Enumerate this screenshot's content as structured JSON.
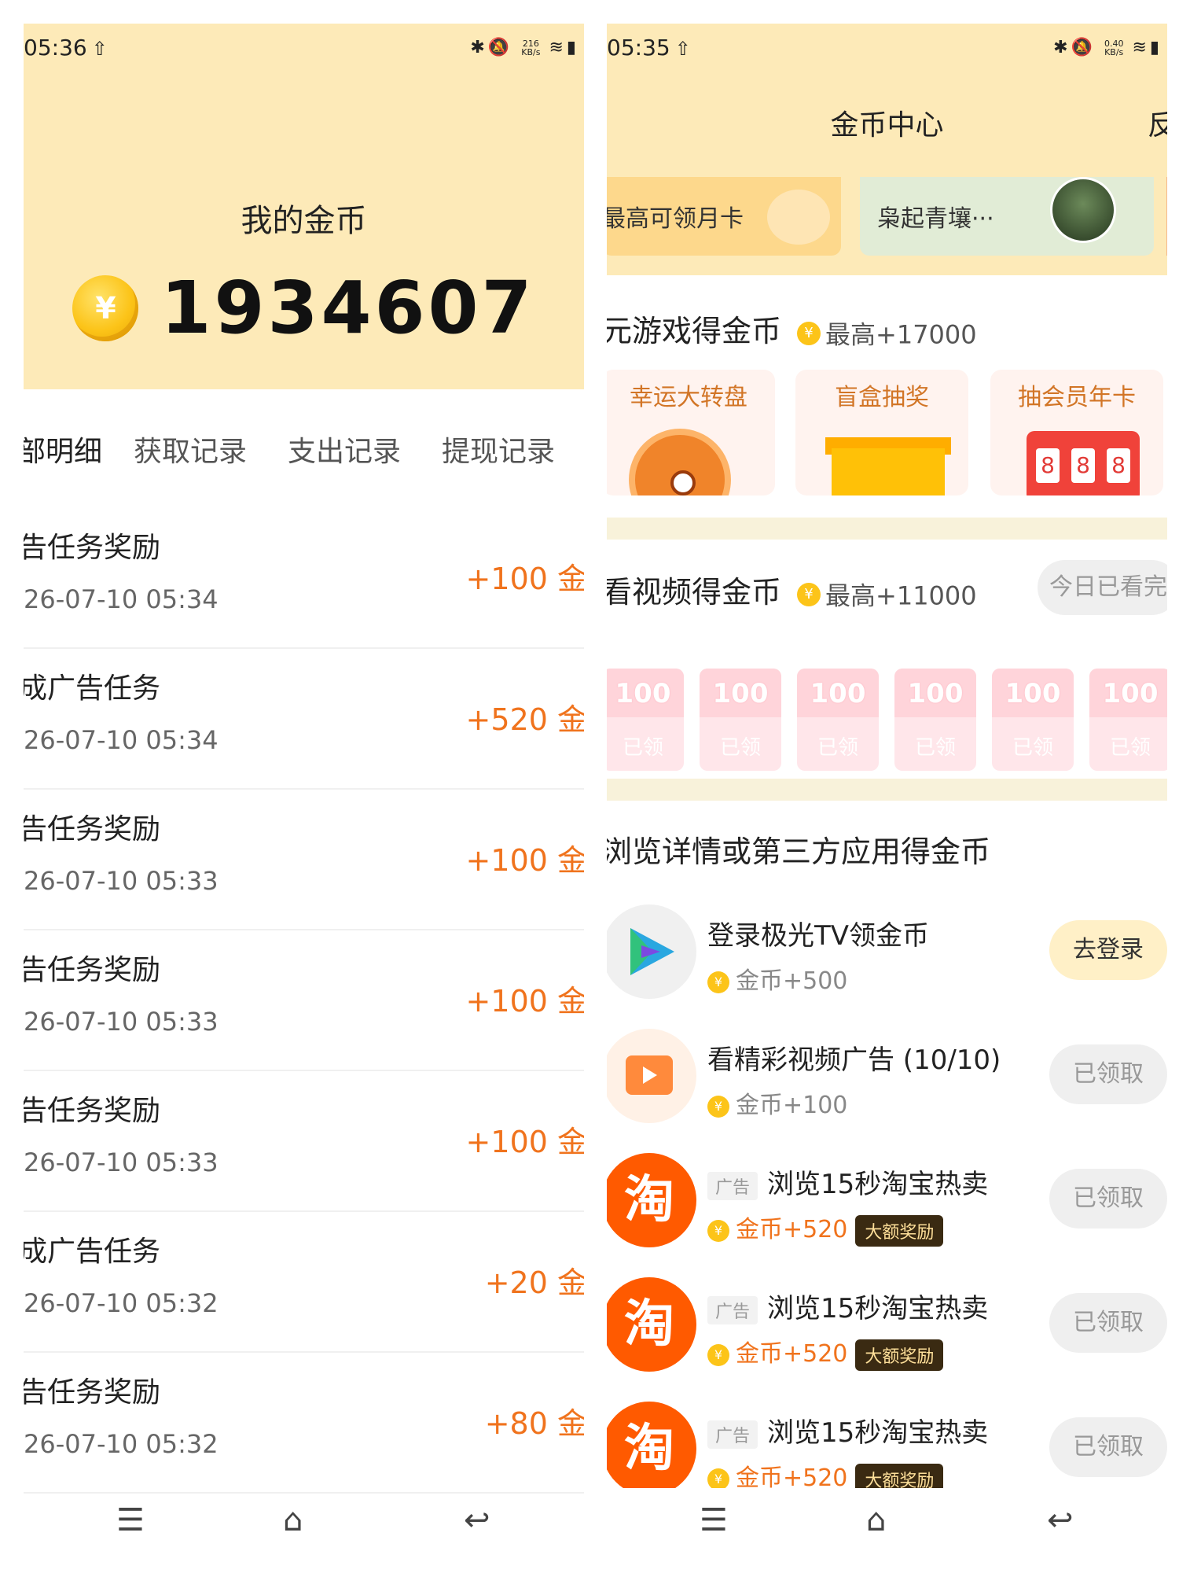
{
  "left": {
    "status": {
      "time": "05:36",
      "speed_value": "216",
      "speed_unit": "KB/s"
    },
    "header": {
      "title": "我的金币",
      "coin_symbol": "¥",
      "balance": "1934607"
    },
    "tabs": [
      "部明细",
      "获取记录",
      "支出记录",
      "提现记录"
    ],
    "records": [
      {
        "title": "告任务奖励",
        "time": "26-07-10 05:34",
        "amount": "+100 金"
      },
      {
        "title": "成广告任务",
        "time": "26-07-10 05:34",
        "amount": "+520 金"
      },
      {
        "title": "告任务奖励",
        "time": "26-07-10 05:33",
        "amount": "+100 金"
      },
      {
        "title": "告任务奖励",
        "time": "26-07-10 05:33",
        "amount": "+100 金"
      },
      {
        "title": "告任务奖励",
        "time": "26-07-10 05:33",
        "amount": "+100 金"
      },
      {
        "title": "成广告任务",
        "time": "26-07-10 05:32",
        "amount": "+20 金"
      },
      {
        "title": "告任务奖励",
        "time": "26-07-10 05:32",
        "amount": "+80 金"
      }
    ]
  },
  "right": {
    "status": {
      "time": "05:35",
      "speed_value": "0.40",
      "speed_unit": "KB/s"
    },
    "header": {
      "title": "金币中心",
      "feedback": "反"
    },
    "cards": [
      {
        "text": "最高可领月卡"
      },
      {
        "text": "枭起青壤···"
      }
    ],
    "games": {
      "title": "元游戏得金币",
      "max": "最高+17000",
      "items": [
        {
          "label": "幸运大转盘"
        },
        {
          "label": "盲盒抽奖"
        },
        {
          "label": "抽会员年卡",
          "digits": [
            "8",
            "8",
            "8"
          ]
        }
      ]
    },
    "videos": {
      "title": "看视频得金币",
      "max": "最高+11000",
      "status": "今日已看完",
      "envelopes": [
        {
          "num": "100",
          "label": "已领"
        },
        {
          "num": "100",
          "label": "已领"
        },
        {
          "num": "100",
          "label": "已领"
        },
        {
          "num": "100",
          "label": "已领"
        },
        {
          "num": "100",
          "label": "已领"
        },
        {
          "num": "100",
          "label": "已领"
        }
      ]
    },
    "browse": {
      "title": "浏览详情或第三方应用得金币",
      "tasks": [
        {
          "title": "登录极光TV领金币",
          "reward": "金币+500",
          "button": "去登录"
        },
        {
          "title": "看精彩视频广告 (10/10)",
          "reward": "金币+100",
          "button": "已领取"
        },
        {
          "ad": "广告",
          "title": "浏览15秒淘宝热卖",
          "reward": "金币+520",
          "badge": "大额奖励",
          "button": "已领取",
          "icon_char": "淘"
        },
        {
          "ad": "广告",
          "title": "浏览15秒淘宝热卖",
          "reward": "金币+520",
          "badge": "大额奖励",
          "button": "已领取",
          "icon_char": "淘"
        },
        {
          "ad": "广告",
          "title": "浏览15秒淘宝热卖",
          "reward": "金币+520",
          "badge": "大额奖励",
          "button": "已领取",
          "icon_char": "淘"
        }
      ]
    }
  },
  "colors": {
    "header_bg": "#fdeab8",
    "accent_orange": "#f0731d",
    "coin_gold": "#fcc419"
  }
}
